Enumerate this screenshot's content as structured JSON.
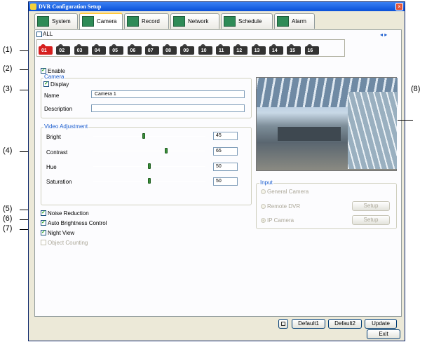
{
  "window": {
    "title": "DVR Configuration Setup",
    "close_glyph": "×"
  },
  "tabs": [
    {
      "label": "System",
      "icon": "system-icon"
    },
    {
      "label": "Camera",
      "icon": "camera-icon"
    },
    {
      "label": "Record",
      "icon": "record-icon"
    },
    {
      "label": "Network",
      "icon": "network-icon"
    },
    {
      "label": "Schedule",
      "icon": "schedule-icon"
    },
    {
      "label": "Alarm",
      "icon": "alarm-icon"
    }
  ],
  "all_label": "ALL",
  "nav_arrows": "◂ ▸",
  "cameras": [
    "01",
    "02",
    "03",
    "04",
    "05",
    "06",
    "07",
    "08",
    "09",
    "10",
    "11",
    "12",
    "13",
    "14",
    "15",
    "16"
  ],
  "enable": {
    "label": "Enable",
    "checked": true
  },
  "camera_group": {
    "title": "Camera",
    "display_label": "Display",
    "name_label": "Name",
    "name_value": "Camera 1",
    "description_label": "Description",
    "description_value": ""
  },
  "video": {
    "title": "Video Adjustment",
    "bright": {
      "label": "Bright",
      "value": "45"
    },
    "contrast": {
      "label": "Contrast",
      "value": "65"
    },
    "hue": {
      "label": "Hue",
      "value": "50"
    },
    "saturation": {
      "label": "Saturation",
      "value": "50"
    }
  },
  "options": {
    "noise": "Noise Reduction",
    "auto_bright": "Auto Brightness Control",
    "night": "Night View",
    "counting": "Object Counting"
  },
  "input": {
    "title": "Input",
    "general": "General Camera",
    "remote": "Remote DVR",
    "ip": "IP Camera",
    "setup": "Setup"
  },
  "buttons": {
    "default1": "Default1",
    "default2": "Default2",
    "update": "Update",
    "exit": "Exit"
  },
  "callouts": {
    "c1": "(1)",
    "c2": "(2)",
    "c3": "(3)",
    "c4": "(4)",
    "c5": "(5)",
    "c6": "(6)",
    "c7": "(7)",
    "c8": "(8)"
  }
}
